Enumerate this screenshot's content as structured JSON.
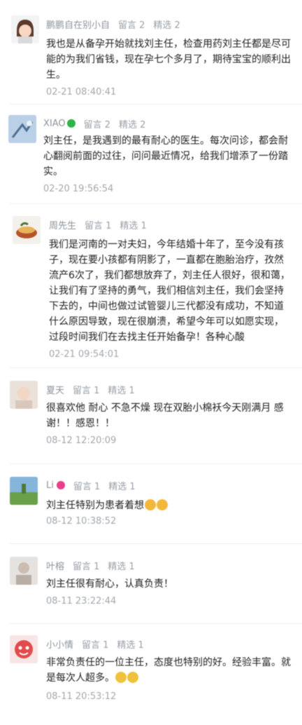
{
  "comments": [
    {
      "nickname": "鹏鹏自在别小自",
      "reply_count": "留言 2",
      "featured_count": "精选 2",
      "text": "我也是从备孕开始就找刘主任，检查用药刘主任都是尽可能的为我们省钱，现在孕七个多月了，期待宝宝的顺利出生。",
      "time": "02-21 08:40:41",
      "avatar_icon": "cartoon-girl-avatar"
    },
    {
      "nickname": "XIAO",
      "reply_count": "留言 2",
      "featured_count": "精选 2",
      "text": "刘主任，是我遇到的最有耐心的医生。每次问诊，都会耐心翻阅前面的过往，问问最近情况，给我们增添了一份踏实。",
      "time": "02-20 19:56:54",
      "avatar_icon": "sky-photo-avatar",
      "badge_color": "#2db34a"
    },
    {
      "nickname": "周先生",
      "reply_count": "留言 1",
      "featured_count": "精选 1",
      "text": "我们是河南的一对夫妇，今年结婚十年了，至今没有孩子，现在要小孩都有阴影了，一直都在胞胎治疗，孜然流产6次了，我们都想放弃了，刘主任人很好，很和蔼，让我们有了坚持的勇气，我们相信刘主任，我们会坚持下去的，中间也做过试管婴儿三代都没有成功，不知道什么原因导致，现在很崩溃，希望今年可以如愿实现，过段时间我们在去找主任开始备孕！各种心酸",
      "time": "02-21 09:54:01",
      "avatar_icon": "food-bowl-avatar"
    },
    {
      "nickname": "夏天",
      "reply_count": "留言 1",
      "featured_count": "精选 1",
      "text": "很喜欢他 耐心 不急不燥 现在双胎小棉袄今天刚满月 感谢！！感恩！！",
      "time": "08-12 12:20:09",
      "avatar_icon": "baby-photo-avatar"
    },
    {
      "nickname": "Li",
      "reply_count": "留言 1",
      "featured_count": "精选 1",
      "text": "刘主任特别为患者着想",
      "time": "08-12 10:38:52",
      "avatar_icon": "landscape-avatar",
      "badge_color": "#e83e8c",
      "trailing_emoji": [
        "thumbs-up-icon",
        "thumbs-up-icon"
      ]
    },
    {
      "nickname": "叶榕",
      "reply_count": "留言 1",
      "featured_count": "精选 1",
      "text": "刘主任很有耐心，认真负责！",
      "time": "08-11 23:22:44",
      "avatar_icon": "person-photo-avatar"
    },
    {
      "nickname": "小小情",
      "reply_count": "留言 1",
      "featured_count": "精选 1",
      "text": "非常负责任的一位主任，态度也特别的好。经验丰富。就是每次人超多。",
      "time": "08-11 20:53:12",
      "avatar_icon": "red-cartoon-avatar",
      "trailing_emoji": [
        "crying-face-icon",
        "crying-face-icon"
      ]
    }
  ]
}
